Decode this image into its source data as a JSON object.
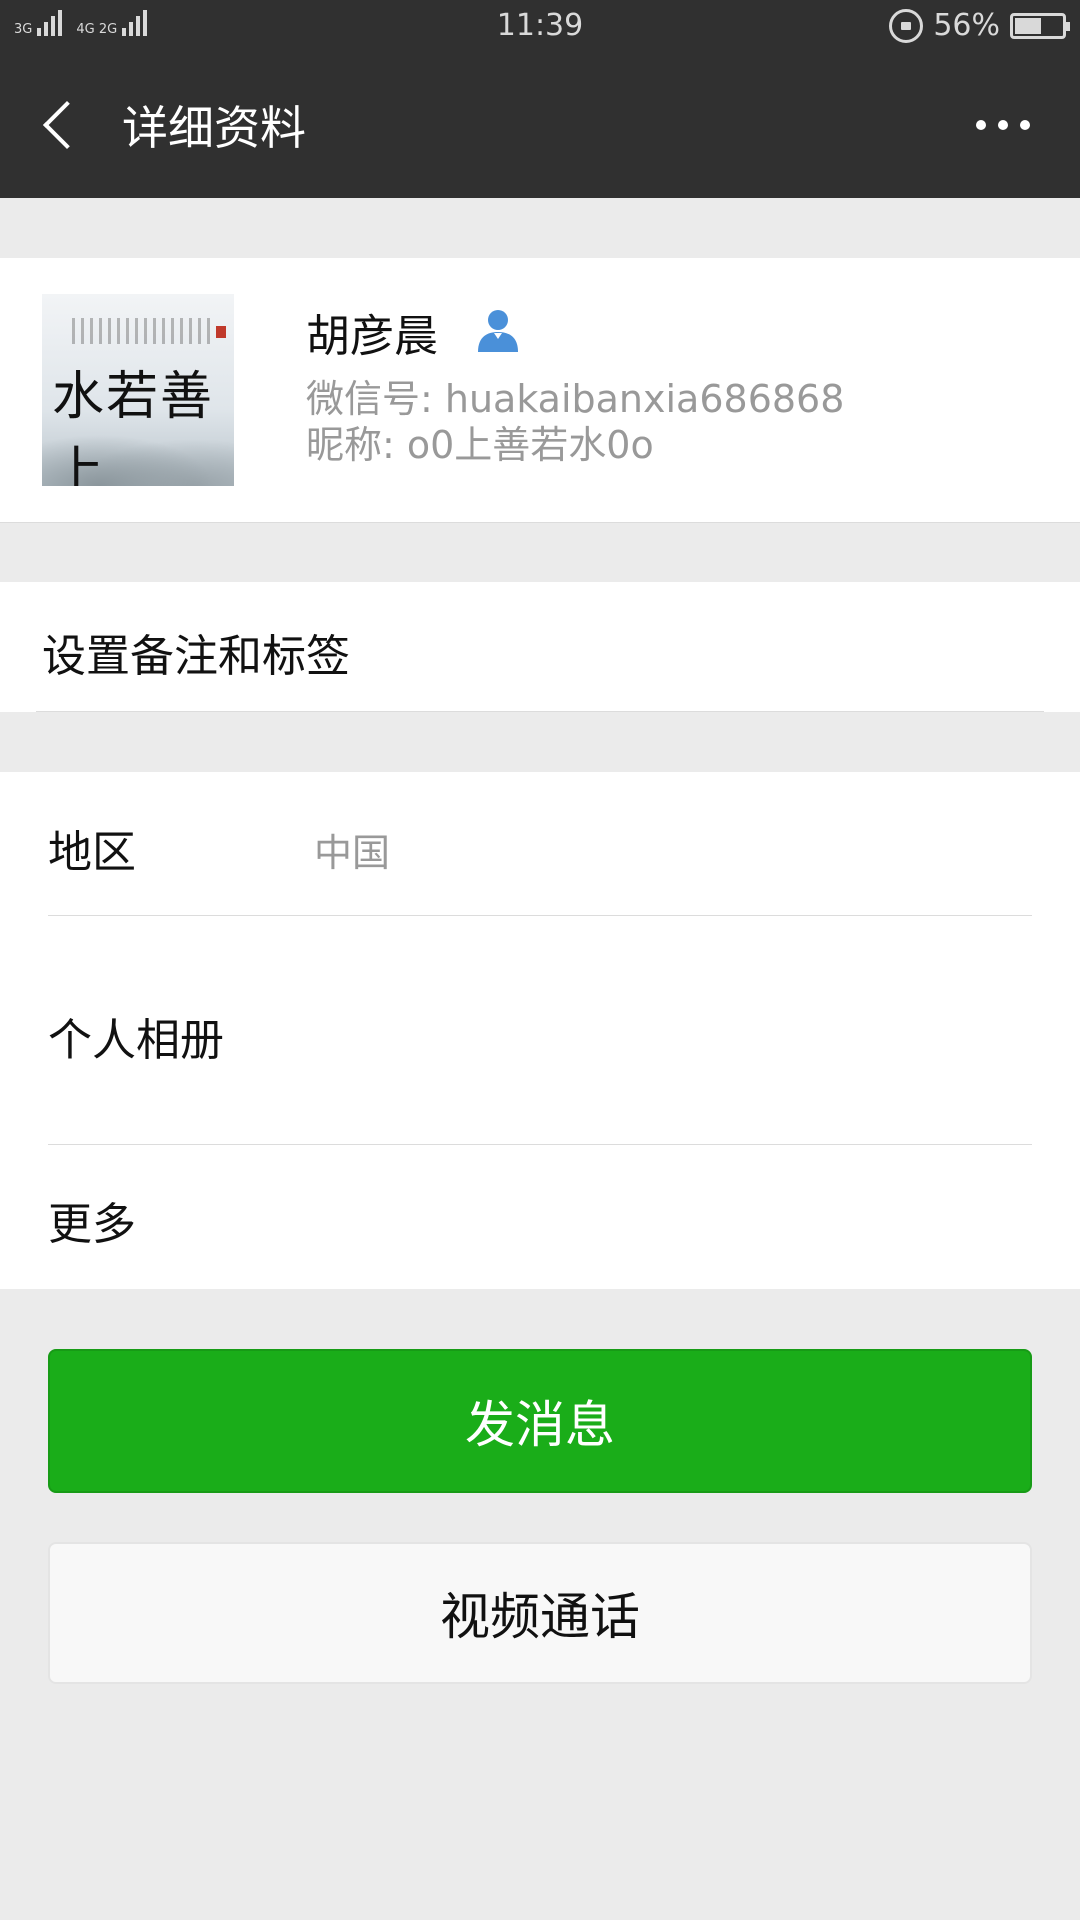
{
  "status_bar": {
    "signal1_label": "3G",
    "signal2_label": "4G 2G",
    "time": "11:39",
    "battery_percent_text": "56%",
    "battery_level": 0.56
  },
  "header": {
    "title": "详细资料",
    "back_icon": "chevron-left-icon",
    "more_icon": "more-dots-icon"
  },
  "profile": {
    "name": "胡彦晨",
    "wechat_id": "微信号: huakaibanxia686868",
    "nickname": "昵称: o0上善若水0o",
    "avatar_text": "水若善上"
  },
  "remark_row": {
    "label": "设置备注和标签"
  },
  "info_rows": {
    "region_label": "地区",
    "region_value": "中国",
    "album_label": "个人相册",
    "more_label": "更多"
  },
  "buttons": {
    "send_message": "发消息",
    "video_call": "视频通话"
  },
  "colors": {
    "header_bg": "#303030",
    "primary_green": "#1aad19",
    "page_bg": "#ebebeb"
  }
}
